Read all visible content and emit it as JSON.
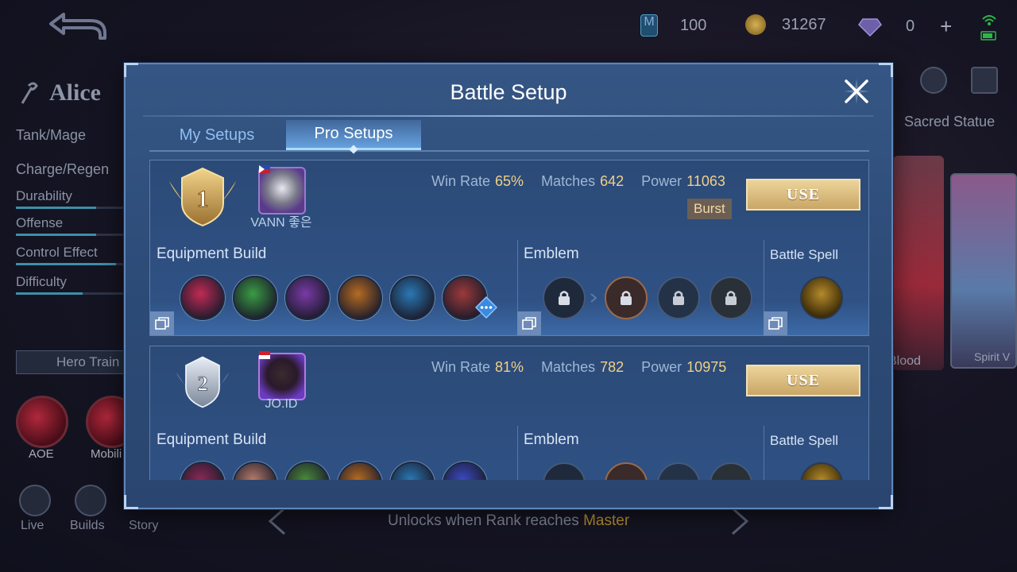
{
  "background": {
    "hero_name": "Alice",
    "role": "Tank/Mage",
    "specialty": "Charge/Regen",
    "stats": [
      {
        "label": "Durability",
        "value": 0.72
      },
      {
        "label": "Offense",
        "value": 0.72
      },
      {
        "label": "Control Effect",
        "value": 0.9
      },
      {
        "label": "Difficulty",
        "value": 0.6
      }
    ],
    "hero_training": "Hero Train",
    "skill_labels": [
      "AOE",
      "Mobili"
    ],
    "bottom_nav": [
      "Live",
      "Builds",
      "Story"
    ],
    "currency": {
      "battle_points_icon": "M",
      "tickets": "100",
      "gold": "31267",
      "diamonds": "0"
    },
    "right_tab": "Sacred Statue",
    "card_labels": [
      "Blood",
      "Spirit V"
    ],
    "unlock_text_prefix": "Unlocks when Rank reaches ",
    "unlock_text_rank": "Master"
  },
  "modal": {
    "title": "Battle Setup",
    "tabs": [
      {
        "label": "My Setups",
        "active": false
      },
      {
        "label": "Pro Setups",
        "active": true
      }
    ],
    "stat_labels": {
      "win_rate": "Win Rate",
      "matches": "Matches",
      "power": "Power"
    },
    "use_label": "USE",
    "section_labels": {
      "equipment": "Equipment Build",
      "emblem": "Emblem",
      "spell": "Battle Spell"
    },
    "setups": [
      {
        "rank": "1",
        "player": "VANN 좋은",
        "win_rate": "65%",
        "matches": "642",
        "power": "11063",
        "tag": "Burst",
        "items": [
          "#c12a55",
          "#3a9b44",
          "#7a3aa6",
          "#b56b22",
          "#2a78b5",
          "#9c3a3a"
        ]
      },
      {
        "rank": "2",
        "player": "JO.ID",
        "win_rate": "81%",
        "matches": "782",
        "power": "10975",
        "tag": "",
        "items": [
          "#8a2a55",
          "#b57a6a",
          "#4a8a3a",
          "#b56b22",
          "#2a78b5",
          "#3a4ac0"
        ]
      }
    ]
  },
  "colors": {
    "accent_gold": "#f0d089",
    "tab_active": "#73b4f5",
    "use_button": "#d9b97c"
  }
}
